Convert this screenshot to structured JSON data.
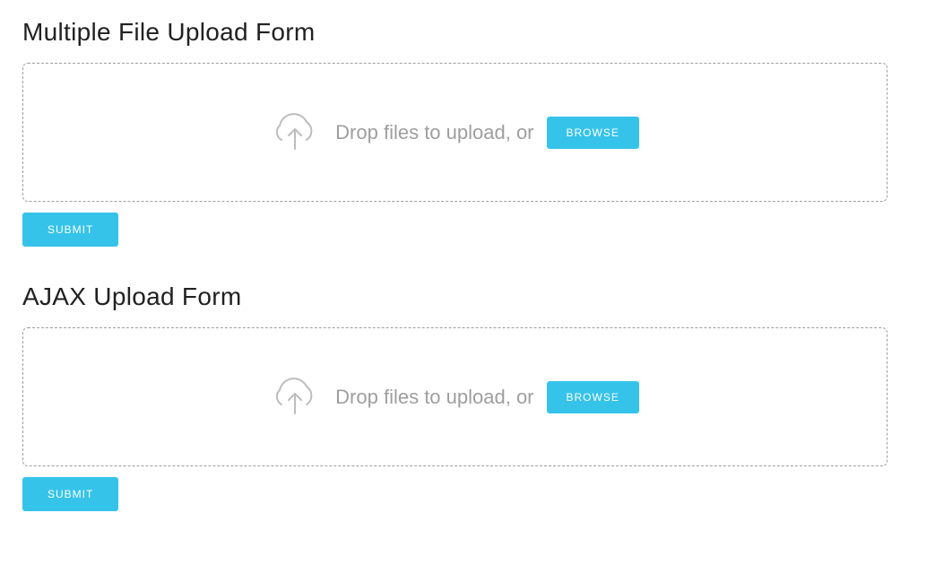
{
  "forms": [
    {
      "title": "Multiple File Upload Form",
      "drop_text": "Drop files to upload, or",
      "browse_label": "BROWSE",
      "submit_label": "SUBMIT"
    },
    {
      "title": "AJAX Upload Form",
      "drop_text": "Drop files to upload, or",
      "browse_label": "BROWSE",
      "submit_label": "SUBMIT"
    }
  ]
}
